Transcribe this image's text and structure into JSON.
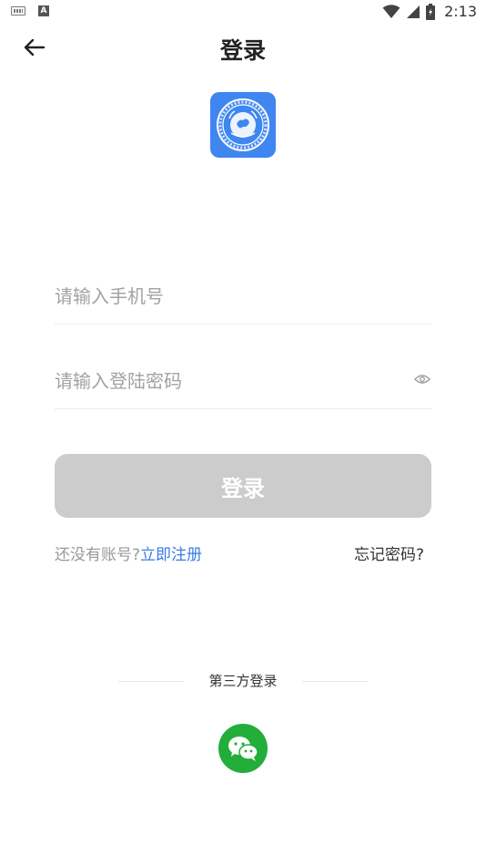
{
  "status_bar": {
    "time": "2:13"
  },
  "header": {
    "title": "登录"
  },
  "form": {
    "phone_placeholder": "请输入手机号",
    "phone_value": "",
    "password_placeholder": "请输入登陆密码",
    "password_value": ""
  },
  "login_button": {
    "label": "登录"
  },
  "links": {
    "no_account_text": "还没有账号?",
    "register_label": "立即注册",
    "forgot_label": "忘记密码?"
  },
  "third_party": {
    "label": "第三方登录"
  },
  "icons": {
    "back": "arrow-left-icon",
    "eye": "eye-icon",
    "wechat": "wechat-icon",
    "logo": "emblem-logo-icon"
  },
  "colors": {
    "accent_link": "#3a7ce6",
    "login_disabled": "#cccccc",
    "logo_bg": "#3f86f0",
    "wechat": "#23ad3a"
  }
}
